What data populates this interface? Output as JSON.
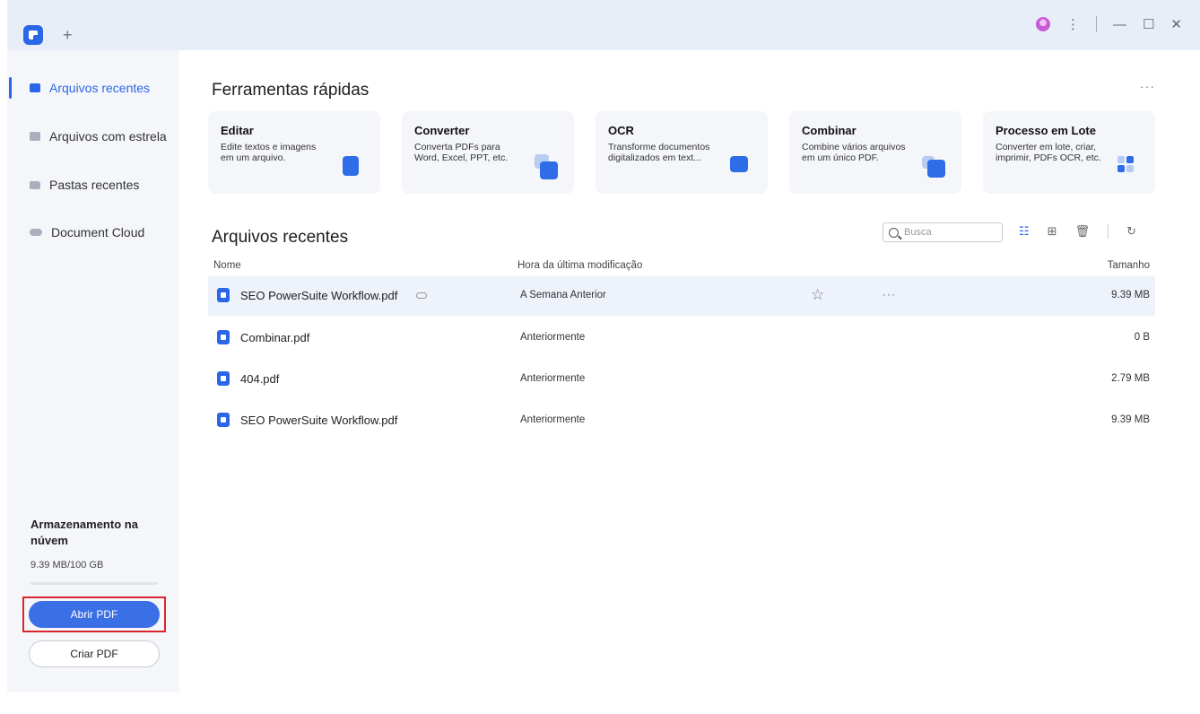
{
  "titlebar": {
    "new_tab_label": "+",
    "menu_label": "⋮",
    "minimize_label": "—",
    "maximize_label": "☐",
    "close_label": "✕"
  },
  "sidebar": {
    "items": [
      {
        "label": "Arquivos recentes",
        "icon": "recent-files-icon"
      },
      {
        "label": "Arquivos com estrela",
        "icon": "starred-files-icon"
      },
      {
        "label": "Pastas recentes",
        "icon": "folder-icon"
      },
      {
        "label": "Document Cloud",
        "icon": "cloud-icon"
      }
    ],
    "storage_title": "Armazenamento na núvem",
    "storage_size": "9.39 MB/100 GB",
    "storage_progress": 0.0001,
    "open_pdf_label": "Abrir PDF",
    "create_pdf_label": "Criar PDF"
  },
  "quick_tools": {
    "title": "Ferramentas rápidas",
    "more_label": "···",
    "cards": [
      {
        "title": "Editar",
        "desc": "Edite textos e imagens em um arquivo."
      },
      {
        "title": "Converter",
        "desc": "Converta PDFs para Word, Excel, PPT, etc."
      },
      {
        "title": "OCR",
        "desc": "Transforme documentos digitalizados em text..."
      },
      {
        "title": "Combinar",
        "desc": "Combine vários arquivos em um único PDF."
      },
      {
        "title": "Processo em Lote",
        "desc": "Converter em lote, criar, imprimir, PDFs OCR, etc."
      }
    ]
  },
  "recent": {
    "title": "Arquivos recentes",
    "search_placeholder": "Busca",
    "columns": {
      "name": "Nome",
      "modified": "Hora da última modificação",
      "size": "Tamanho"
    },
    "files": [
      {
        "name": "SEO PowerSuite Workflow.pdf",
        "modified": "A Semana Anterior",
        "size": "9.39 MB"
      },
      {
        "name": "Combinar.pdf",
        "modified": "Anteriormente",
        "size": "0 B"
      },
      {
        "name": "404.pdf",
        "modified": "Anteriormente",
        "size": "2.79 MB"
      },
      {
        "name": "SEO PowerSuite Workflow.pdf",
        "modified": "Anteriormente",
        "size": "9.39 MB"
      }
    ],
    "row_more_label": "···",
    "star_label": "☆"
  },
  "colors": {
    "accent": "#2a66e8",
    "highlight": "#d9262c",
    "sidebar_bg": "#f4f6fa",
    "titlebar_bg": "#e8eef8"
  }
}
